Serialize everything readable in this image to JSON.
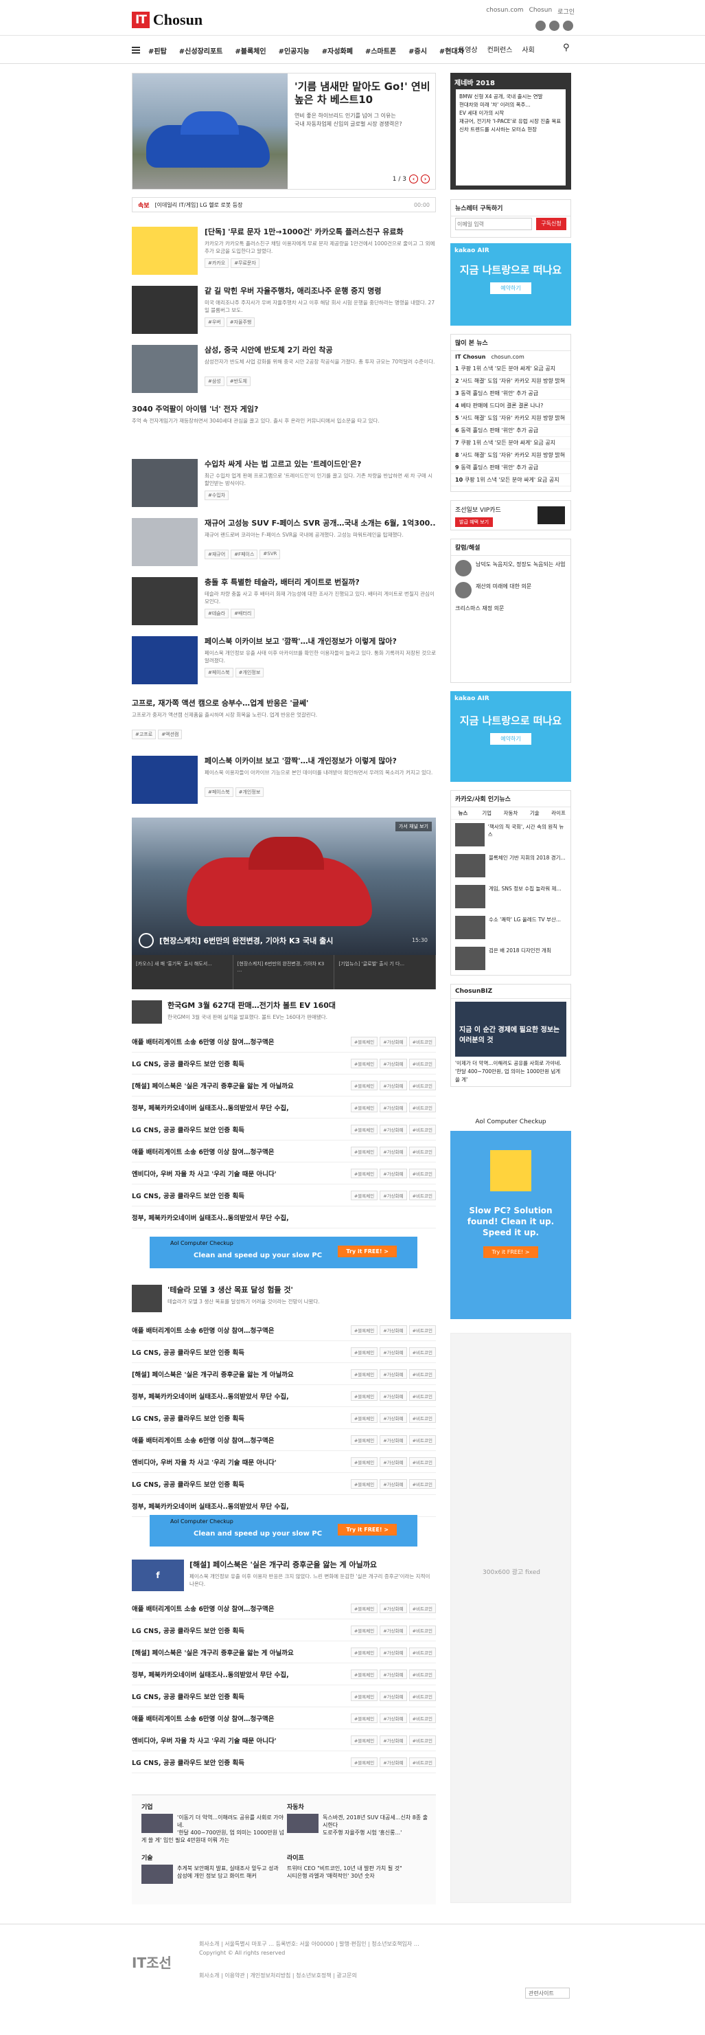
{
  "header": {
    "logo_box": "IT",
    "logo_name": "Chosun",
    "top_links": [
      "chosun.com",
      "Chosun",
      "로그인"
    ],
    "nav": [
      "#핀탑",
      "#신성장리포트",
      "#블록체인",
      "#인공지능",
      "#자성화폐",
      "#스마트폰",
      "#증시",
      "#현대차"
    ],
    "nav_right": [
      "동영상",
      "컨퍼런스",
      "사회"
    ]
  },
  "hero": {
    "title": "'기름 냄새만 맡아도 Go!' 연비 높은 차 베스트10",
    "bullets": [
      "연비 좋은 하이브리드 인기를 넘어 그 이유는",
      "국내 자동차업체 신입의 글로벌 시장 경쟁력은?"
    ],
    "page": "1 / 3"
  },
  "ticker": {
    "label": "속보",
    "text": "[이데일리 IT/게임] LG 헬로 로봇 등장",
    "meta": "00:00"
  },
  "articles": [
    {
      "title": "[단독] '무료 문자 1만→1000건' 카카오톡 플러스친구 유료화",
      "desc": "카카오가 카카오톡 플러스친구 채팅 이용자에게 무료 문자 제공량을 1만건에서 1000건으로 줄이고 그 외에 추가 요금을 도입한다고 알렸다.",
      "tags": [
        "#카카오",
        "#무료문자"
      ]
    },
    {
      "title": "같 길 막힌 우버 자율주행차, 애리조나주 운행 중지 명령",
      "desc": "미국 애리조나주 주지사가 우버 자율주행차 사고 이후 해당 회사 시험 운행을 중단하라는 명령을 내렸다. 27일 블룸버그 보도.",
      "tags": [
        "#우버",
        "#자율주행"
      ]
    },
    {
      "title": "삼성, 중국 시안에 반도체 2기 라인 착공",
      "desc": "삼성전자가 반도체 사업 강화를 위해 중국 시안 2공장 착공식을 가졌다. 총 투자 규모는 70억달러 수준이다.",
      "tags": [
        "#삼성",
        "#반도체"
      ]
    },
    {
      "title": "3040 주억팔이 아이템 '너' 전자 게임?",
      "desc": "추억 속 전자게임기가 재등장하면서 3040세대 관심을 끌고 있다. 출시 후 온라인 커뮤니티에서 입소문을 타고 있다.",
      "tags": []
    },
    {
      "title": "수입차 싸게 사는 법 고르고 있는 '트레이드인'은?",
      "desc": "최근 수입차 업계 판매 프로그램으로 '트레이드인'이 인기를 끌고 있다. 기존 차량을 반납하면 새 차 구매 시 할인받는 방식이다.",
      "tags": [
        "#수입차"
      ]
    },
    {
      "title": "재규어 고성능 SUV F-페이스 SVR 공개…국내 소개는 6월, 1억300..",
      "desc": "재규어 랜드로버 코리아는 F-페이스 SVR을 국내에 공개했다. 고성능 파워트레인을 탑재했다.",
      "tags": [
        "#재규어",
        "#F페이스",
        "#SVR"
      ]
    },
    {
      "title": "충돌 후 특별한 테슬라, 배터리 게이트로 번질까?",
      "desc": "테슬라 차량 충돌 사고 후 배터리 화재 가능성에 대한 조사가 진행되고 있다. 배터리 게이트로 번질지 관심이 모인다.",
      "tags": [
        "#테슬라",
        "#배터리"
      ]
    },
    {
      "title": "페이스북 이카이브 보고 '깜짝'…내 개인정보가 이렇게 많아?",
      "desc": "페이스북 개인정보 유출 사태 이후 아카이브를 확인한 이용자들이 놀라고 있다. 통화 기록까지 저장된 것으로 알려졌다.",
      "tags": [
        "#페이스북",
        "#개인정보"
      ]
    },
    {
      "title": "고프로, 재가쪽 액션 캠으로 승부수…업계 반응은 '글쎄'",
      "desc": "고프로가 중저가 액션캠 신제품을 출시하며 시장 회복을 노린다. 업계 반응은 엇갈린다.",
      "tags": [
        "#고프로",
        "#액션캠"
      ]
    },
    {
      "title": "페이스북 이카이브 보고 '깜짝'…내 개인정보가 이렇게 많아?",
      "desc": "페이스북 이용자들이 아카이브 기능으로 본인 데이터를 내려받아 확인하면서 우려의 목소리가 커지고 있다.",
      "tags": [
        "#페이스북",
        "#개인정보"
      ]
    }
  ],
  "video": {
    "label": "가서 채널 보기",
    "title": "[현장스케치] 6번만의 완전변경, 기아차 K3 국내 출시",
    "time": "15:30",
    "thumbs": [
      "[카오스] 새 패 '홍기독' 출시 해도서...",
      "[현장스케치] 6번만의 완전변경, 기아차 K3 ...",
      "[기업뉴스] '글로벌' 출시 기 다..."
    ]
  },
  "tesla": {
    "title": "한국GM 3월 627대 판매…전기차 볼트 EV 160대",
    "desc": "한국GM이 3월 국내 판매 실적을 발표했다. 볼트 EV는 160대가 판매됐다.",
    "tags": []
  },
  "tesla2": {
    "title": "'테슬라 모델 3 생산 목표 달성 험들 것'",
    "desc": "테슬라가 모델 3 생산 목표를 달성하기 어려울 것이라는 전망이 나왔다.",
    "tags": []
  },
  "facebook": {
    "title": "[해설] 페이스북은 '실은 개구리 증후군을 앓는 게 아닐까요",
    "desc": "페이스북 개인정보 유출 이후 이용자 반응은 크지 않았다. 느린 변화에 둔감한 '실은 개구리 증후군'이라는 지적이 나온다.",
    "tags": []
  },
  "list": [
    "애플 배터리게이트 소송 6만명 이상 참여…청구액은",
    "LG CNS, 공공 클라우드 보안 인증 획득",
    "[해설] 페이스북은 '실은 개구리 증후군을 앓는 게 아닐까요",
    "정부, 페북카카오네이버 실태조사..동의받았서 무단 수집,",
    "LG CNS, 공공 클라우드 보안 인증 획득",
    "애플 배터리게이트 소송 6만명 이상 참여…청구액은",
    "엔비디아, 우버 자율 차 사고 '우리 기술 때문 아니다'",
    "LG CNS, 공공 클라우드 보안 인증 획득",
    "정부, 페북카카오네이버 실태조사..동의받았서 무단 수집,"
  ],
  "row_tags": [
    "#블록체인",
    "#가상화폐",
    "#비트코인"
  ],
  "ad": {
    "logo": "Aol Computer Checkup",
    "message": "Clean and speed up your slow PC",
    "button": "Try it FREE! >"
  },
  "bottom": [
    {
      "h": "기업",
      "items": [
        "'이동기 더 악역...이해려도 공유를 사회로 가야네.",
        "'한달 400~700만원, 업 의미는 1000만원 넘게 쓸 게' 입인 필요 4만원대 이뤄 가는"
      ]
    },
    {
      "h": "자동차",
      "items": [
        "독스바겐, 2018년 SUV 대공세...신차 8종 출시한다",
        "도로주행 자율주행 시험 '흥신롱...'"
      ]
    },
    {
      "h": "기술",
      "items": [
        "추게북 보안패치 발표, 실태조사 앞두고 성과",
        "삼성에 개인 정보 담고 화이트 해커"
      ]
    },
    {
      "h": "라이프",
      "items": [
        "트위터 CEO \"비트코인, 10년 내 발판 가치 될 것\"",
        "시티은행 라엘과 '매력적인' 30년 숫자"
      ]
    }
  ],
  "sidebar": {
    "banner_title": "제네바 2018",
    "banner_items": [
      "BMW 신형 X4 공개, 국내 출시는 연말",
      "현대차와 미래 '차' 이러의 폭주...",
      "EV 세대 이가의 시작",
      "재규어, 전기차 'I-PACE'로 유럽 시장 진출 목표",
      "신차 트렌드를 시사하는 모터쇼 현장"
    ],
    "newsletter": "뉴스레터 구독하기",
    "newsletter_placeholder": "이메일 입력",
    "newsletter_btn": "구독신청",
    "kakao_title": "kakao AIR",
    "kakao_text": "지금 나트랑으로 떠나요",
    "kakao_btn": "예약하기",
    "popular": "많이 본 뉴스",
    "popular_tabs": [
      "IT Chosun",
      "chosun.com"
    ],
    "ranks": [
      "쿠팡 1위 스낵 '모든 분야 싸게' 요금 공지",
      "'사드 해결' 도입 '자유' 카카오 지원 방향 밝혀",
      "동력 홀딩스 판매 '위안' 추가 공급",
      "베타 판매에 드디어 결론 결론 나나?",
      "'사드 해결' 도입 '자유' 카카오 지원 방향 밝혀",
      "동력 홀딩스 판매 '위안' 추가 공급",
      "쿠팡 1위 스낵 '모든 분야 싸게' 요금 공지",
      "'사드 해결' 도입 '자유' 카카오 지원 방향 밝혀",
      "동력 홀딩스 판매 '위안' 추가 공급",
      "쿠팡 1위 스낵 '모든 분야 싸게' 요금 공지"
    ],
    "card_title": "조선일보 VIP카드",
    "card_btn": "발급 혜택 보기",
    "opinion": "칼럼/해설",
    "opinion_items": [
      "남덕도 녹음지오, 정장도 녹음되는 사업",
      "재산의 미래에 대한 의문",
      "크리스마스 재정 의문"
    ],
    "column": "카카오/사회 인기뉴스",
    "column_tabs": [
      "뉴스",
      "기업",
      "자동차",
      "기술",
      "라이프"
    ],
    "column_items": [
      "'책사의 직 국회', 시간 속의 원칙 뉴스",
      "블록체인 기반 지휘의 2018 경기...",
      "게임, SNS 정보 수집 놀라워 제...",
      "수소 '쾌락' LG 올레드 TV 부산...",
      "검은 배 2018 디자인전 개최"
    ],
    "biz": "ChosunBIZ",
    "biz_headline": "지금 이 순간 경제에 필요한 정보는 여러분의 것",
    "biz_items": [
      "'이제가 더 악역...이해려도 공유를 사회로 가야네.",
      "'한달 400~700만원, 업 의미는 1000만원 넘게 쓸 게'"
    ],
    "aol_logo": "Aol Computer Checkup",
    "aol_title": "Slow PC? Solution found! Clean it up. Speed it up.",
    "aol_btn": "Try it FREE! >",
    "ad_note": "300x600 광고 fixed"
  },
  "footer": {
    "logo": "IT조선",
    "text": "회사소개 | 서울특별시 마포구 … 등록번호: 서울 아00000 | 발행·편집인 | 청소년보호책임자 …",
    "copy": "Copyright © All rights reserved",
    "links": "회사소개 | 이용약관 | 개인정보처리방침 | 청소년보호정책 | 광고문의",
    "family": "관련사이트"
  }
}
